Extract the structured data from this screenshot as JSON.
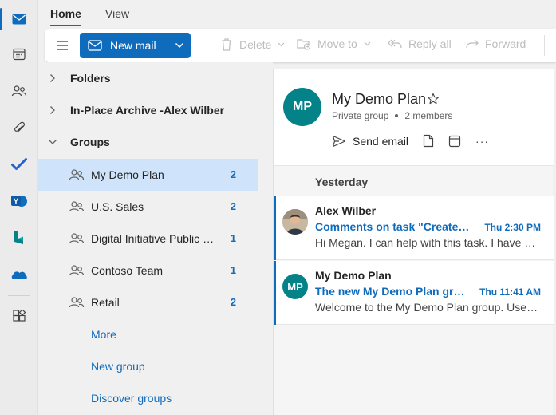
{
  "tabs": [
    {
      "label": "Home",
      "active": true
    },
    {
      "label": "View",
      "active": false
    }
  ],
  "toolbar": {
    "new_mail_label": "New mail",
    "delete_label": "Delete",
    "move_to_label": "Move to",
    "reply_all_label": "Reply all",
    "forward_label": "Forward"
  },
  "folders": {
    "top": [
      {
        "label": "Folders",
        "expanded": false
      },
      {
        "label": "In-Place Archive -Alex Wilber",
        "expanded": false
      },
      {
        "label": "Groups",
        "expanded": true
      }
    ],
    "groups": [
      {
        "label": "My Demo Plan",
        "count": "2",
        "selected": true
      },
      {
        "label": "U.S. Sales",
        "count": "2"
      },
      {
        "label": "Digital Initiative Public Relations",
        "count": "1"
      },
      {
        "label": "Contoso Team",
        "count": "1"
      },
      {
        "label": "Retail",
        "count": "2"
      }
    ],
    "links": [
      {
        "label": "More"
      },
      {
        "label": "New group"
      },
      {
        "label": "Discover groups"
      }
    ]
  },
  "group_header": {
    "initials": "MP",
    "title": "My Demo Plan",
    "privacy": "Private group",
    "members": "2 members",
    "send_email_label": "Send email",
    "more_label": "···"
  },
  "messages": {
    "date_header": "Yesterday",
    "items": [
      {
        "sender": "Alex Wilber",
        "subject": "Comments on task \"Create the sales plan\"",
        "time": "Thu 2:30 PM",
        "preview": "Hi Megan. I can help with this task. I have experience with this."
      },
      {
        "sender": "My Demo Plan",
        "initials": "MP",
        "subject": "The new My Demo Plan group is ready",
        "time": "Thu 11:41 AM",
        "preview": "Welcome to the My Demo Plan group. Use the group to share ideas."
      }
    ]
  },
  "colors": {
    "accent": "#0f6cbd",
    "selected_bg": "#cfe4fa",
    "group_avatar": "#038387"
  }
}
